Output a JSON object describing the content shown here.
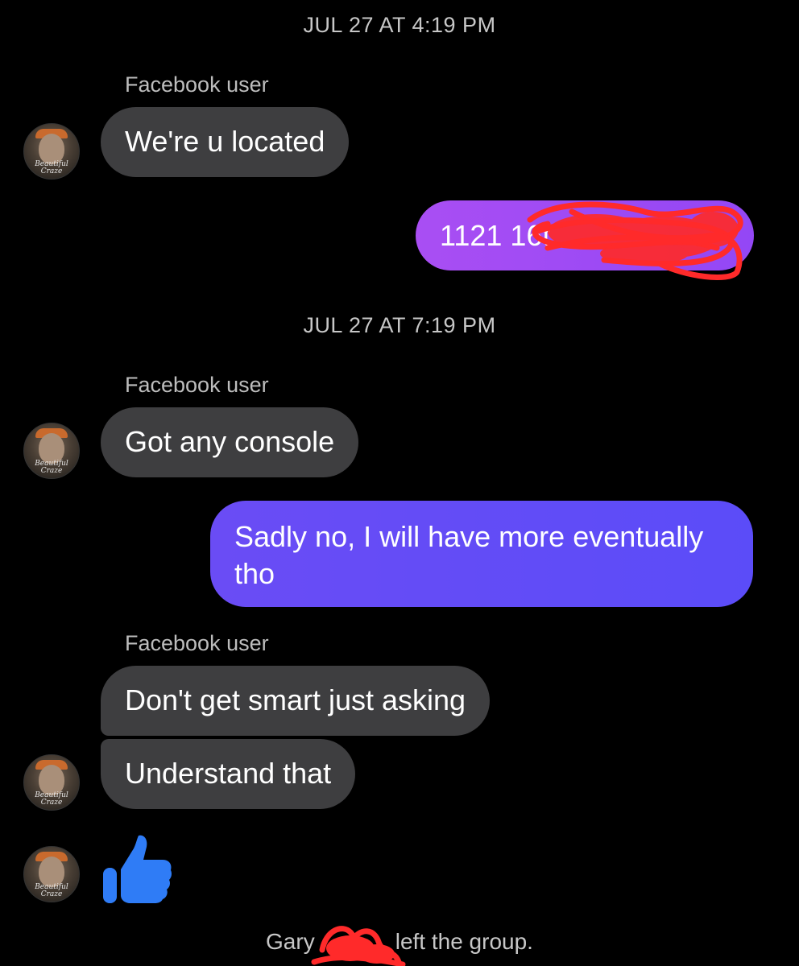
{
  "timestamps": [
    "JUL 27 AT 4:19 PM",
    "JUL 27 AT 7:19 PM"
  ],
  "messages": {
    "sender_name": "Facebook user",
    "m1": "We're u located",
    "m2_visible": "1121 16t",
    "m3": "Got any console",
    "m4": "Sadly no, I will have more eventually tho",
    "m5": "Don't get smart just asking",
    "m6": "Understand that"
  },
  "avatar": {
    "caption_line1": "Beautiful",
    "caption_line2": "Craze"
  },
  "reaction": {
    "icon": "thumbs-up-icon",
    "color": "#2f7cf6"
  },
  "system": {
    "name_start": "Gary",
    "text": "left the group."
  },
  "colors": {
    "background": "#000000",
    "incoming_bubble": "#3e3e40",
    "outgoing_pink": "#a94ef3",
    "outgoing_blue": "#5b4cf8",
    "redaction": "#ff2a2a"
  }
}
